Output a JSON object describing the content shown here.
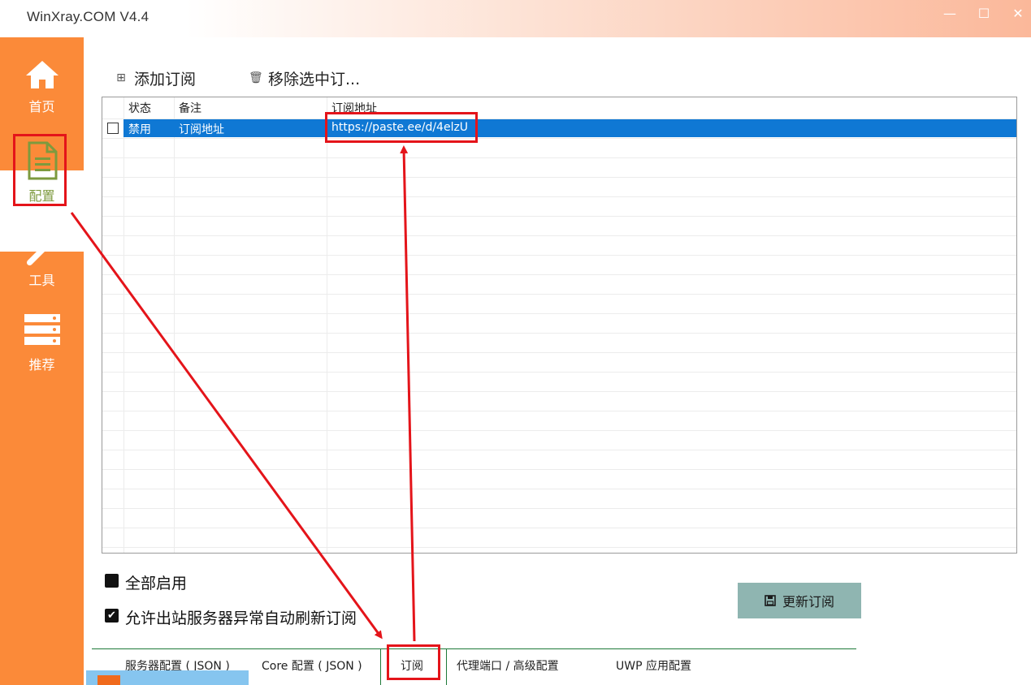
{
  "window": {
    "title": "WinXray.COM   V4.4",
    "minimize_glyph": "—",
    "maximize_glyph": "☐",
    "close_glyph": "✕"
  },
  "sidebar": {
    "items": [
      {
        "label": "首页",
        "icon": "home-icon"
      },
      {
        "label": "配置",
        "icon": "document-icon",
        "active": true
      },
      {
        "label": "工具",
        "icon": "wrench-icon"
      },
      {
        "label": "推荐",
        "icon": "server-icon"
      }
    ]
  },
  "toolbar": {
    "add_label": "添加订阅",
    "remove_label": "移除选中订..."
  },
  "grid": {
    "columns": [
      "状态",
      "备注",
      "订阅地址"
    ],
    "rows": [
      {
        "checked": false,
        "status": "禁用",
        "remark": "订阅地址",
        "url": "https://paste.ee/d/4elzU",
        "selected": true
      }
    ]
  },
  "options": {
    "enable_all_label": "全部启用",
    "auto_refresh_label": "允许出站服务器异常自动刷新订阅",
    "enable_all_checked": false,
    "auto_refresh_checked": true
  },
  "actions": {
    "update_label": "更新订阅"
  },
  "tabs": [
    {
      "label": "服务器配置 ( JSON )"
    },
    {
      "label": "Core 配置 ( JSON )"
    },
    {
      "label": "订阅",
      "active": true
    },
    {
      "label": "代理端口 / 高级配置"
    },
    {
      "label": "UWP 应用配置"
    }
  ],
  "colors": {
    "sidebar": "#fb8a39",
    "selection": "#0f78d4",
    "annotation": "#e4141a",
    "update_button": "#8fb5b1",
    "tab_border": "#1e7a39"
  }
}
